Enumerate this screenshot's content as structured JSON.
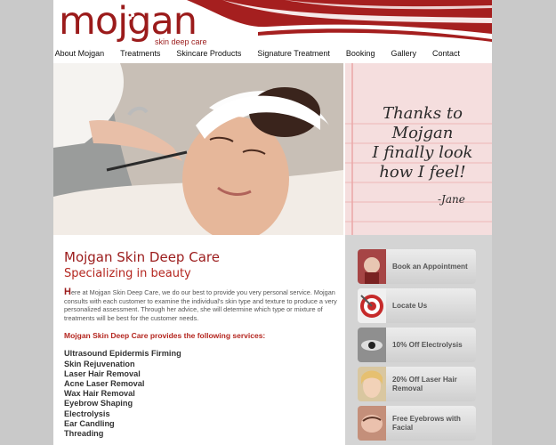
{
  "logo": {
    "wordmark": "mojgan",
    "tagline": "skin deep care"
  },
  "nav": [
    "About Mojgan",
    "Treatments",
    "Skincare Products",
    "Signature Treatment",
    "Booking",
    "Gallery",
    "Contact"
  ],
  "testimonial": {
    "lines": [
      "Thanks to",
      "Mojgan",
      "I finally look",
      "how I feel!"
    ],
    "signature": "-Jane"
  },
  "main": {
    "title": "Mojgan Skin Deep Care",
    "subtitle": "Specializing in beauty",
    "intro_dropcap": "H",
    "intro": "ere at Mojgan Skin Deep Care, we do our best to provide you very personal service. Mojgan consults with each customer to examine the individual's skin type and texture to produce a very personalized assessment. Through her advice, she will determine which type or mixture of treatments will be best for the customer needs.",
    "services_heading": "Mojgan Skin Deep Care provides the following services:",
    "services": [
      "Ultrasound Epidermis Firming",
      "Skin Rejuvenation",
      "Laser Hair Removal",
      "Acne Laser Removal",
      "Wax Hair Removal",
      "Eyebrow Shaping",
      "Electrolysis",
      "Ear Candling",
      "Threading"
    ]
  },
  "sidebar": [
    {
      "label": "Book an Appointment",
      "icon": "appointment-icon"
    },
    {
      "label": "Locate Us",
      "icon": "target-icon"
    },
    {
      "label": "10% Off Electrolysis",
      "icon": "eye-closeup-icon"
    },
    {
      "label": "20% Off Laser Hair Removal",
      "icon": "face-icon"
    },
    {
      "label": "Free Eyebrows with Facial",
      "icon": "eyebrow-icon"
    }
  ],
  "colors": {
    "brand": "#9b1b1b",
    "accent": "#b4261f",
    "sidebar_bg": "#d4d4d4"
  }
}
